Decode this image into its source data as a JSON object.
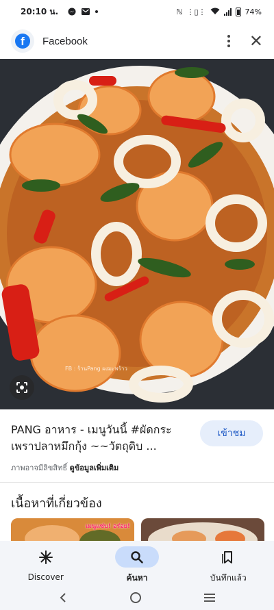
{
  "status_bar": {
    "time": "20:10 น.",
    "battery": "74%"
  },
  "tab_bar": {
    "title": "Facebook"
  },
  "result": {
    "title": "PANG อาหาร - เมนูวันนี้ #ผัดกระเพราปลาหมึกกุ้ง ~~วัตถุดิบ ...",
    "visit_label": "เข้าชม",
    "copyright_text": "ภาพอาจมีลิขสิทธิ์",
    "more_info_link": "ดูข้อมูลเพิ่มเติม"
  },
  "related": {
    "heading": "เนื้อหาที่เกี่ยวข้อง",
    "thumb1_tag": "เมนูแซ่บ! อร่อย!"
  },
  "bottom_nav": {
    "items": [
      {
        "label": "Discover",
        "icon": "asterisk-icon"
      },
      {
        "label": "ค้นหา",
        "icon": "search-icon"
      },
      {
        "label": "บันทึกแล้ว",
        "icon": "bookmark-icon"
      }
    ],
    "active_index": 1
  },
  "colors": {
    "accent": "#1a56c4",
    "active_pill": "#c9dcfb",
    "nav_bg": "#f3f5f9",
    "facebook_blue": "#1877f2"
  }
}
